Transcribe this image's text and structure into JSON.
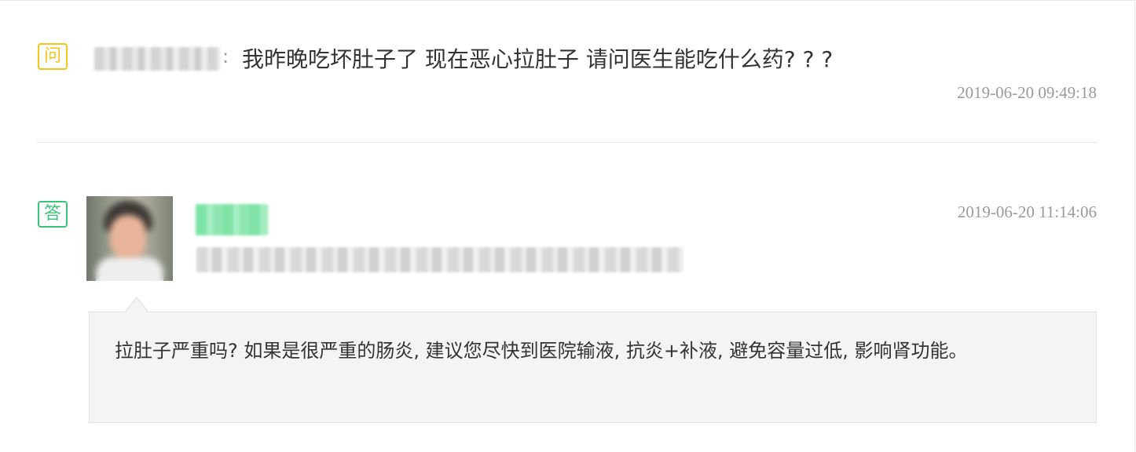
{
  "question": {
    "tag_label": "问",
    "asker_name": "",
    "separator": ":",
    "text": "我昨晚吃坏肚子了 现在恶心拉肚子 请问医生能吃什么药? ? ?",
    "timestamp": "2019-06-20 09:49:18"
  },
  "answer": {
    "tag_label": "答",
    "doctor_name": "",
    "doctor_title": "",
    "timestamp": "2019-06-20 11:14:06",
    "text": "拉肚子严重吗? 如果是很严重的肠炎, 建议您尽快到医院输液, 抗炎+补液, 避免容量过低, 影响肾功能。"
  },
  "colors": {
    "question_tag": "#f5c518",
    "answer_tag": "#3cc37a",
    "bubble_bg": "#f3f4f6",
    "timestamp": "#9a9a9a"
  },
  "icons": {
    "avatar": "doctor-avatar-photo"
  }
}
